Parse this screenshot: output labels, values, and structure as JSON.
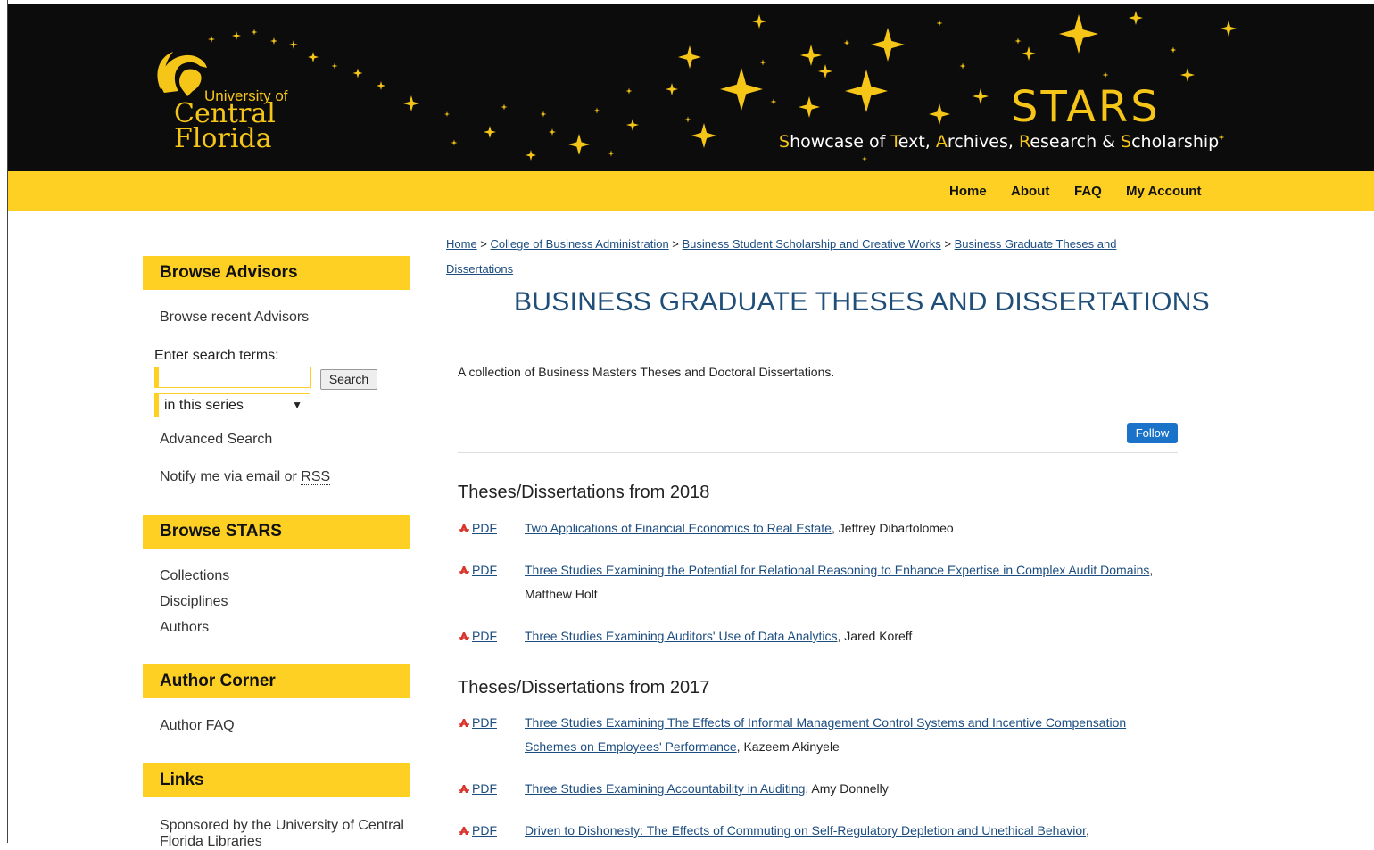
{
  "banner": {
    "ucf_small": "University of",
    "ucf_line1": "Central",
    "ucf_line2": "Florida",
    "stars_word": "STARS",
    "tagline_parts": [
      {
        "cap": "S",
        "rest": "howcase of "
      },
      {
        "cap": "T",
        "rest": "ext, "
      },
      {
        "cap": "A",
        "rest": "rchives, "
      },
      {
        "cap": "R",
        "rest": "esearch & "
      },
      {
        "cap": "S",
        "rest": "cholarship"
      }
    ],
    "colors": {
      "accent": "#fdd023",
      "background": "#0c0c0c"
    }
  },
  "topnav": {
    "home": "Home",
    "about": "About",
    "faq": "FAQ",
    "account": "My Account"
  },
  "sidebar": {
    "advisors_head": "Browse Advisors",
    "recent_advisors": "Browse recent Advisors",
    "search_label": "Enter search terms:",
    "search_value": "",
    "search_button": "Search",
    "scope_value": "in this series",
    "advanced_search": "Advanced Search",
    "notify_prefix": "Notify me via email or ",
    "notify_rss": "RSS",
    "stars_head": "Browse STARS",
    "collections": "Collections",
    "disciplines": "Disciplines",
    "authors": "Authors",
    "corner_head": "Author Corner",
    "author_faq": "Author FAQ",
    "links_head": "Links",
    "sponsored": "Sponsored by the University of Central Florida Libraries"
  },
  "breadcrumb": {
    "home": "Home",
    "college": "College of Business Administration",
    "scholarship": "Business Student Scholarship and Creative Works",
    "current": "Business Graduate Theses and Dissertations",
    "sep": " > "
  },
  "main": {
    "title": "BUSINESS GRADUATE THESES AND DISSERTATIONS",
    "description": "A collection of Business Masters Theses and Doctoral Dissertations.",
    "follow": "Follow",
    "pdf_label": "PDF",
    "sections": [
      {
        "heading": "Theses/Dissertations from 2018",
        "items": [
          {
            "title": "Two Applications of Financial Economics to Real Estate",
            "author": ", Jeffrey Dibartolomeo"
          },
          {
            "title": "Three Studies Examining the Potential for Relational Reasoning to Enhance Expertise in Complex Audit Domains",
            "author": ", Matthew Holt"
          },
          {
            "title": "Three Studies Examining Auditors' Use of Data Analytics",
            "author": ", Jared Koreff"
          }
        ]
      },
      {
        "heading": "Theses/Dissertations from 2017",
        "items": [
          {
            "title": "Three Studies Examining The Effects of Informal Management Control Systems and Incentive Compensation Schemes on Employees' Performance",
            "author": ", Kazeem Akinyele"
          },
          {
            "title": "Three Studies Examining Accountability in Auditing",
            "author": ", Amy Donnelly"
          },
          {
            "title": "Driven to Dishonesty: The Effects of Commuting on Self-Regulatory Depletion and Unethical Behavior",
            "author": ","
          }
        ]
      }
    ]
  }
}
